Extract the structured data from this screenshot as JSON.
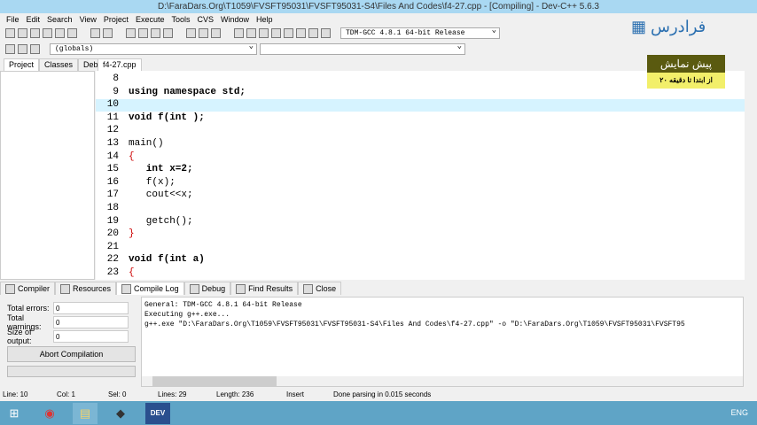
{
  "title": "D:\\FaraDars.Org\\T1059\\FVSFT95031\\FVSFT95031-S4\\Files And Codes\\f4-27.cpp - [Compiling] - Dev-C++ 5.6.3",
  "menu": [
    "File",
    "Edit",
    "Search",
    "View",
    "Project",
    "Execute",
    "Tools",
    "CVS",
    "Window",
    "Help"
  ],
  "compiler_select": "TDM-GCC 4.8.1 64-bit Release",
  "scope_select": "(globals)",
  "left_tabs": [
    "Project",
    "Classes",
    "Debug"
  ],
  "file_tab": "f4-27.cpp",
  "code_lines": [
    {
      "n": "8",
      "t": ""
    },
    {
      "n": "9",
      "t": "using namespace std;"
    },
    {
      "n": "10",
      "t": ""
    },
    {
      "n": "11",
      "t": "void f(int );"
    },
    {
      "n": "12",
      "t": ""
    },
    {
      "n": "13",
      "t": "main()"
    },
    {
      "n": "14",
      "t": "{"
    },
    {
      "n": "15",
      "t": "   int x=2;"
    },
    {
      "n": "16",
      "t": "   f(x);"
    },
    {
      "n": "17",
      "t": "   cout<<x;"
    },
    {
      "n": "18",
      "t": ""
    },
    {
      "n": "19",
      "t": "   getch();"
    },
    {
      "n": "20",
      "t": "}"
    },
    {
      "n": "21",
      "t": ""
    },
    {
      "n": "22",
      "t": "void f(int a)"
    },
    {
      "n": "23",
      "t": "{"
    }
  ],
  "bottom_tabs": [
    "Compiler",
    "Resources",
    "Compile Log",
    "Debug",
    "Find Results",
    "Close"
  ],
  "stats": {
    "errors_label": "Total errors:",
    "errors": "0",
    "warnings_label": "Total warnings:",
    "warnings": "0",
    "size_label": "Size of output:",
    "size": "0",
    "abort": "Abort Compilation"
  },
  "log": [
    "General: TDM-GCC 4.8.1 64-bit Release",
    "Executing g++.exe...",
    "g++.exe \"D:\\FaraDars.Org\\T1059\\FVSFT95031\\FVSFT95031-S4\\Files And Codes\\f4-27.cpp\" -o \"D:\\FaraDars.Org\\T1059\\FVSFT95031\\FVSFT95"
  ],
  "status": {
    "line": "Line:  10",
    "col": "Col:  1",
    "sel": "Sel:  0",
    "lines": "Lines:  29",
    "length": "Length:  236",
    "mode": "Insert",
    "msg": "Done parsing in 0.015 seconds"
  },
  "watermark": {
    "logo": "فرادرس",
    "badge_title": "پیش نمایش",
    "badge_sub": "از ابتدا تا دقیقه ۲۰"
  },
  "taskbar": {
    "lang": "ENG",
    "dev": "DEV"
  }
}
